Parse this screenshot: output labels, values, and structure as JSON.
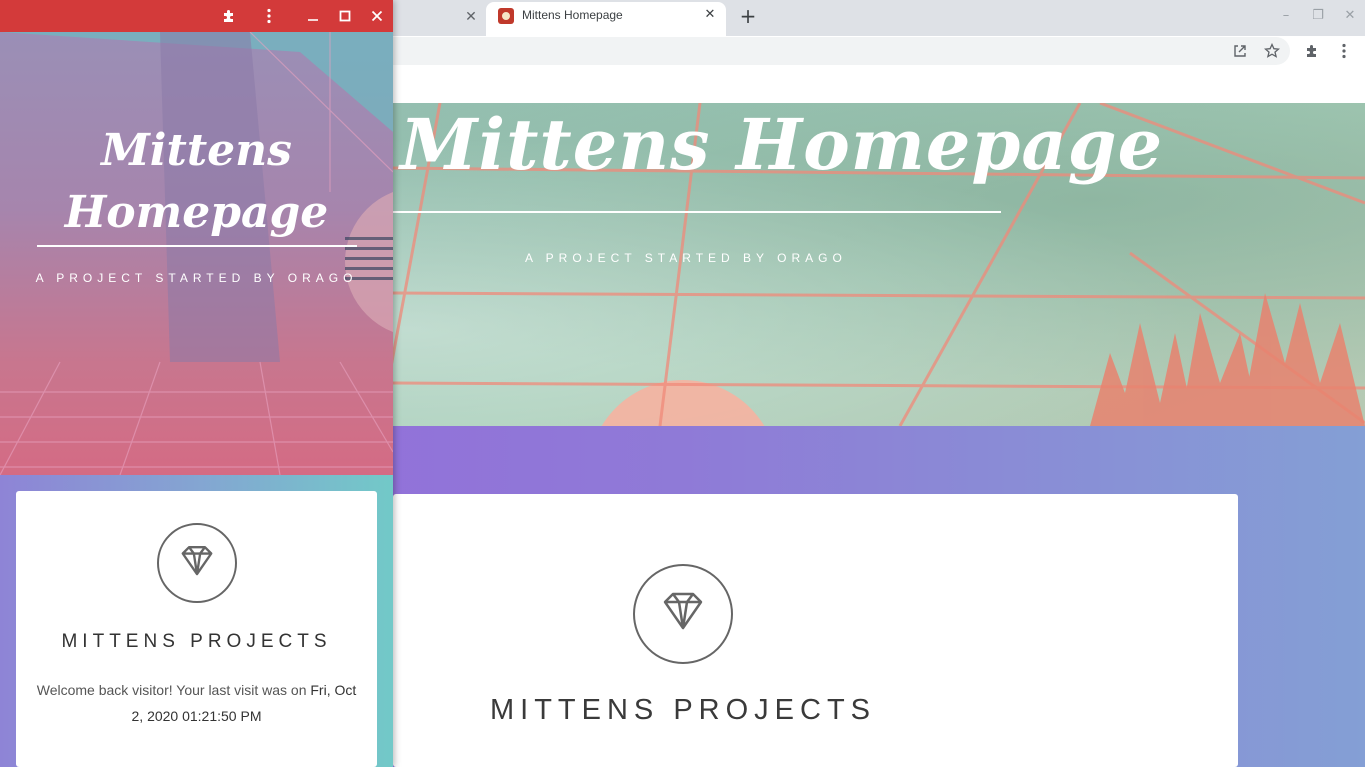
{
  "browser": {
    "active_tab_title": "Mittens Homepage",
    "inactive_tab_close": "✕",
    "active_tab_close": "✕",
    "new_tab": "+",
    "window_controls": [
      "–",
      "❐",
      "✕"
    ],
    "toolbar_icons": [
      "open-in-app-icon",
      "star-icon",
      "extensions-icon",
      "more-vert-icon"
    ]
  },
  "page": {
    "hero_title": "Mittens Homepage",
    "hero_subtitle": "A PROJECT STARTED BY ORAGO",
    "card_heading": "MITTENS PROJECTS",
    "card_icon": "diamond-icon"
  },
  "popup_window": {
    "titlebar_color": "#d33a3a",
    "controls": [
      "extensions-icon",
      "more-vert-icon",
      "minimize-icon",
      "maximize-icon",
      "close-icon"
    ],
    "hero_title": "Mittens Homepage",
    "hero_subtitle": "A PROJECT STARTED BY ORAGO",
    "card_heading": "MITTENS PROJECTS",
    "card_text_prefix": "Welcome back visitor! Your last visit was on ",
    "card_text_date": "Fri, Oct 2, 2020 01:21:50 PM"
  },
  "colors": {
    "band_start": "#9568dc",
    "band_end": "#849fd5",
    "popup_band_end": "#72c9c8"
  }
}
